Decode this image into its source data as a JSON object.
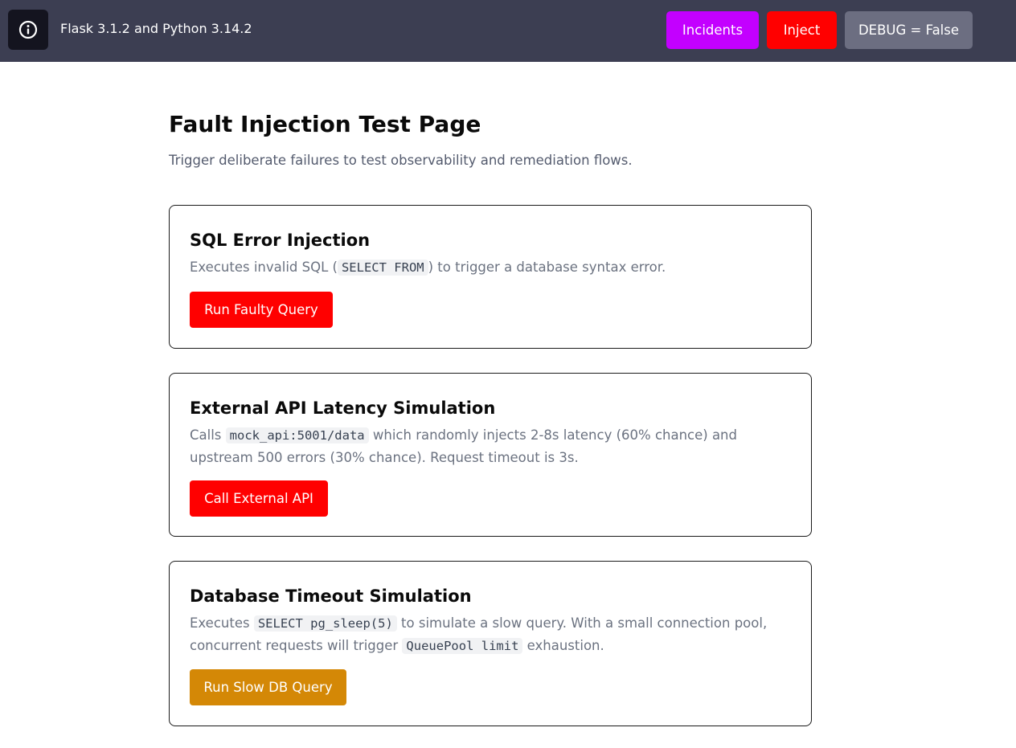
{
  "header": {
    "info_icon": "info-circle-icon",
    "version_text": "Flask 3.1.2 and Python 3.14.2",
    "nav": {
      "incidents_label": "Incidents",
      "inject_label": "Inject",
      "debug_label": "DEBUG = False"
    }
  },
  "page": {
    "title": "Fault Injection Test Page",
    "subtitle": "Trigger deliberate failures to test observability and remediation flows."
  },
  "cards": {
    "sql": {
      "title": "SQL Error Injection",
      "desc_1": "Executes invalid SQL (",
      "code_1": "SELECT FROM",
      "desc_2": ") to trigger a database syntax error.",
      "button_label": "Run Faulty Query"
    },
    "api": {
      "title": "External API Latency Simulation",
      "desc_1": "Calls ",
      "code_1": "mock_api:5001/data",
      "desc_2": " which randomly injects 2-8s latency (60% chance) and upstream 500 errors (30% chance). Request timeout is 3s.",
      "button_label": "Call External API"
    },
    "db": {
      "title": "Database Timeout Simulation",
      "desc_1": "Executes ",
      "code_1": "SELECT pg_sleep(5)",
      "desc_2": " to simulate a slow query. With a small connection pool, concurrent requests will trigger ",
      "code_2": "QueuePool limit",
      "desc_3": " exhaustion.",
      "button_label": "Run Slow DB Query"
    }
  },
  "colors": {
    "topbar": "#3c3e52",
    "incidents": "#c300ff",
    "inject": "#ff0000",
    "debug": "#6c6e81",
    "danger": "#ff0000",
    "warning": "#d48806"
  }
}
